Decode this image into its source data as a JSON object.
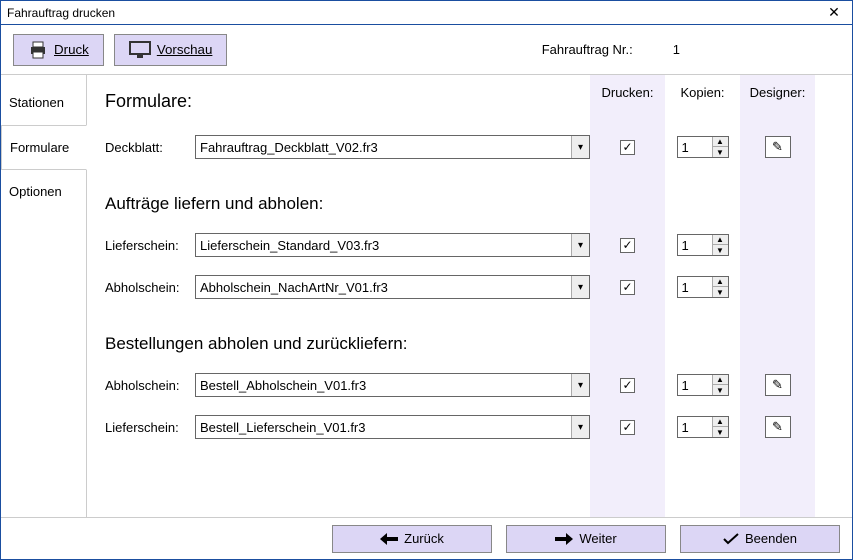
{
  "window": {
    "title": "Fahrauftrag drucken"
  },
  "toolbar": {
    "print": "Druck",
    "preview": "Vorschau",
    "jobnr_label": "Fahrauftrag Nr.:",
    "jobnr_value": "1"
  },
  "tabs": {
    "stations": "Stationen",
    "forms": "Formulare",
    "options": "Optionen"
  },
  "headers": {
    "print": "Drucken:",
    "copies": "Kopien:",
    "designer": "Designer:"
  },
  "section": {
    "title": "Formulare:"
  },
  "group1": {
    "cover_label": "Deckblatt:",
    "cover_value": "Fahrauftrag_Deckblatt_V02.fr3",
    "cover_copies": "1",
    "cover_checked": true,
    "cover_designer": true
  },
  "group2": {
    "title": "Aufträge liefern und abholen:",
    "liefer_label": "Lieferschein:",
    "liefer_value": "Lieferschein_Standard_V03.fr3",
    "liefer_copies": "1",
    "liefer_checked": true,
    "liefer_designer": false,
    "abhol_label": "Abholschein:",
    "abhol_value": "Abholschein_NachArtNr_V01.fr3",
    "abhol_copies": "1",
    "abhol_checked": true,
    "abhol_designer": false
  },
  "group3": {
    "title": "Bestellungen abholen und zurückliefern:",
    "abhol_label": "Abholschein:",
    "abhol_value": "Bestell_Abholschein_V01.fr3",
    "abhol_copies": "1",
    "abhol_checked": true,
    "abhol_designer": true,
    "liefer_label": "Lieferschein:",
    "liefer_value": "Bestell_Lieferschein_V01.fr3",
    "liefer_copies": "1",
    "liefer_checked": true,
    "liefer_designer": true
  },
  "footer": {
    "back": "Zurück",
    "next": "Weiter",
    "close": "Beenden"
  }
}
